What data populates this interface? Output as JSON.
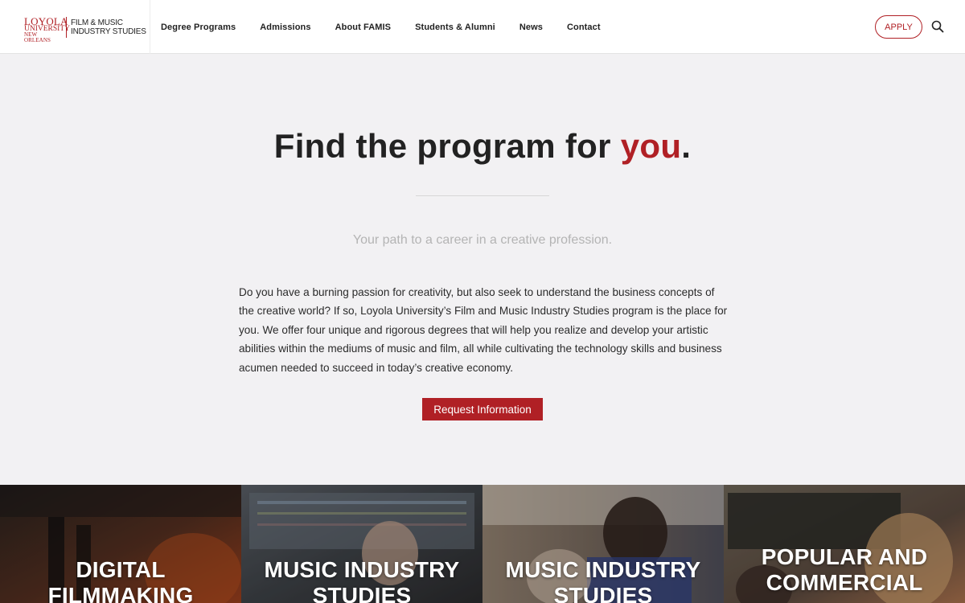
{
  "header": {
    "logo": {
      "line1": "LOYOLA",
      "line2": "UNIVERSITY",
      "line3": "NEW ORLEANS",
      "unit_line1": "FILM & MUSIC",
      "unit_line2": "INDUSTRY STUDIES"
    },
    "nav": [
      {
        "label": "Degree Programs"
      },
      {
        "label": "Admissions"
      },
      {
        "label": "About FAMIS"
      },
      {
        "label": "Students & Alumni"
      },
      {
        "label": "News"
      },
      {
        "label": "Contact"
      }
    ],
    "apply_label": "APPLY",
    "search_icon": "search-icon"
  },
  "hero": {
    "title_prefix": "Find the program for ",
    "title_accent": "you",
    "title_suffix": ".",
    "subtitle": "Your path to a career in a creative profession.",
    "body": "Do you have a burning passion for creativity, but also seek to understand the business concepts of the creative world? If so, Loyola University’s Film and Music Industry Studies program is the place for you. We offer four unique and rigorous degrees that will help you realize and develop your artistic abilities within the mediums of music and film, all while cultivating the technology skills and business acumen needed to succeed in today’s creative economy.",
    "cta_label": "Request Information"
  },
  "programs": [
    {
      "label_line1": "DIGITAL",
      "label_line2": "FILMMAKING"
    },
    {
      "label_line1": "MUSIC INDUSTRY",
      "label_line2": "STUDIES"
    },
    {
      "label_line1": "MUSIC INDUSTRY",
      "label_line2": "STUDIES"
    },
    {
      "label_line1": "POPULAR AND",
      "label_line2": "COMMERCIAL"
    }
  ],
  "colors": {
    "brand_red": "#b02025",
    "page_bg": "#f2f1f3"
  }
}
